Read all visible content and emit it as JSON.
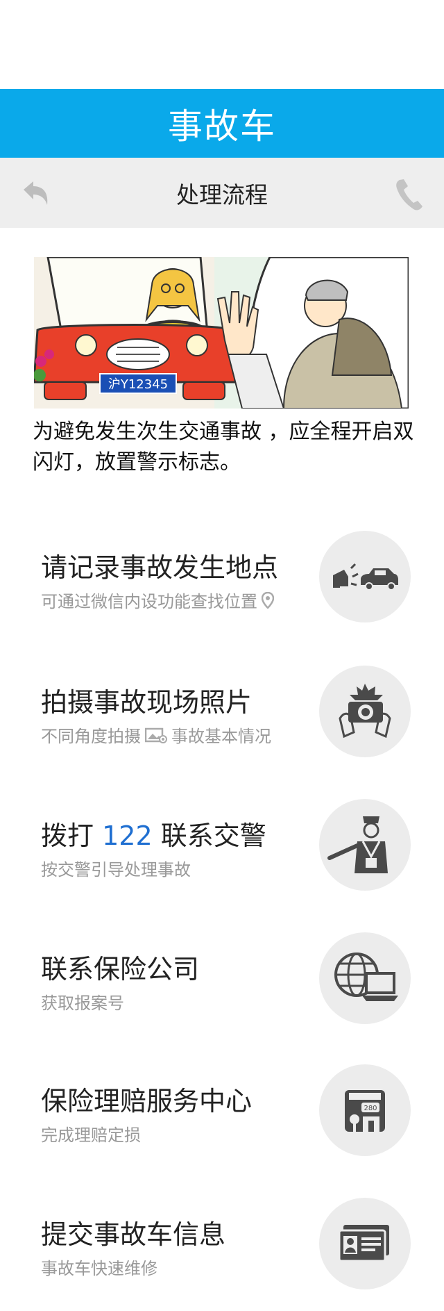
{
  "header": {
    "title": "事故车"
  },
  "subheader": {
    "title": "处理流程"
  },
  "illustration": {
    "plate": "沪Y12345"
  },
  "intro": {
    "text": "为避免发生次生交通事故 ，应全程开启双闪灯，放置警示标志。"
  },
  "steps": [
    {
      "title": "请记录事故发生地点",
      "subtitle": "可通过微信内设功能查找位置",
      "icon": "car-collision-icon"
    },
    {
      "title": "拍摄事故现场照片",
      "subtitle_a": "不同角度拍摄",
      "subtitle_b": "事故基本情况",
      "icon": "camera-icon"
    },
    {
      "title_a": "拨打",
      "title_num": "122",
      "title_b": "联系交警",
      "subtitle": "按交警引导处理事故",
      "icon": "traffic-police-icon"
    },
    {
      "title": "联系保险公司",
      "subtitle": "获取报案号",
      "icon": "globe-laptop-icon"
    },
    {
      "title": "保险理赔服务中心",
      "subtitle": "完成理赔定损",
      "icon": "service-center-icon",
      "badge": "280"
    },
    {
      "title": "提交事故车信息",
      "subtitle": "事故车快速维修",
      "icon": "id-card-icon"
    }
  ],
  "colors": {
    "accent": "#0aa9ea",
    "number": "#1f6fd1",
    "subtitle": "#999999"
  }
}
